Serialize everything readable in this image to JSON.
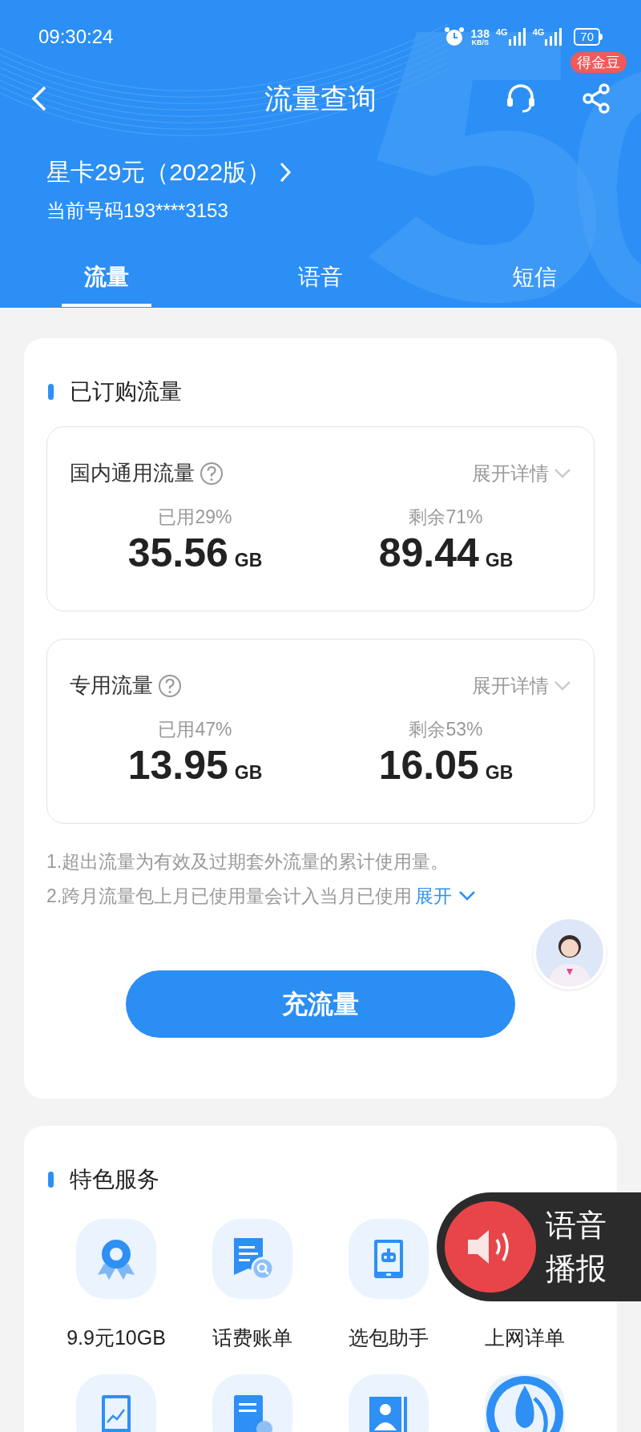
{
  "status_bar": {
    "time": "09:30:24",
    "speed": "138",
    "speed_unit": "KB/S",
    "networks": [
      "4G",
      "4G"
    ],
    "battery": "70"
  },
  "nav": {
    "title": "流量查询",
    "badge": "得金豆"
  },
  "plan": {
    "name": "星卡29元（2022版）",
    "number": "当前号码193****3153"
  },
  "tabs": [
    {
      "label": "流量",
      "selected": true
    },
    {
      "label": "语音",
      "selected": false
    },
    {
      "label": "短信",
      "selected": false
    }
  ],
  "subscribed": {
    "title": "已订购流量",
    "pools": [
      {
        "name": "国内通用流量",
        "expand": "展开详情",
        "used_label": "已用29%",
        "used_value": "35.56",
        "used_unit": "GB",
        "remain_label": "剩余71%",
        "remain_value": "89.44",
        "remain_unit": "GB"
      },
      {
        "name": "专用流量",
        "expand": "展开详情",
        "used_label": "已用47%",
        "used_value": "13.95",
        "used_unit": "GB",
        "remain_label": "剩余53%",
        "remain_value": "16.05",
        "remain_unit": "GB"
      }
    ],
    "notes": [
      "1.超出流量为有效及过期套外流量的累计使用量。",
      "2.跨月流量包上月已使用量会计入当月已使用"
    ],
    "notes_expand": "展开",
    "action": "充流量"
  },
  "services": {
    "title": "特色服务",
    "items": [
      {
        "label": "9.9元10GB",
        "kind": "ribbon"
      },
      {
        "label": "话费账单",
        "kind": "bill"
      },
      {
        "label": "选包助手",
        "kind": "phone"
      },
      {
        "label": "上网详单"
      },
      {
        "kind": "chart"
      },
      {
        "kind": "doc"
      },
      {
        "kind": "contact"
      },
      {
        "kind": "drop"
      }
    ]
  },
  "voice_overlay": {
    "lines": [
      "语音",
      "播报"
    ]
  }
}
